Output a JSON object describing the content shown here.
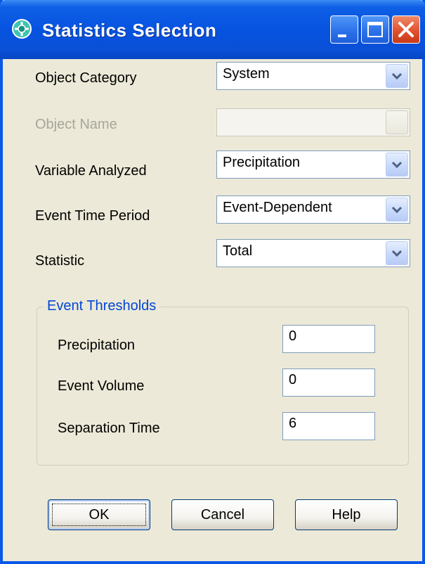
{
  "window": {
    "title": "Statistics Selection",
    "icon": "swmm-app-icon"
  },
  "fields": {
    "object_category": {
      "label": "Object Category",
      "value": "System"
    },
    "object_name": {
      "label": "Object Name",
      "value": ""
    },
    "variable_analyzed": {
      "label": "Variable Analyzed",
      "value": "Precipitation"
    },
    "event_time_period": {
      "label": "Event Time Period",
      "value": "Event-Dependent"
    },
    "statistic": {
      "label": "Statistic",
      "value": "Total"
    }
  },
  "thresholds": {
    "title": "Event Thresholds",
    "precipitation": {
      "label": "Precipitation",
      "value": "0"
    },
    "event_volume": {
      "label": "Event Volume",
      "value": "0"
    },
    "separation_time": {
      "label": "Separation Time",
      "value": "6"
    }
  },
  "buttons": {
    "ok": "OK",
    "cancel": "Cancel",
    "help": "Help"
  },
  "colors": {
    "titlebar": "#0653e0",
    "dialog_bg": "#ece9d8",
    "group_title": "#0046d5",
    "disabled_text": "#a7a69a"
  }
}
